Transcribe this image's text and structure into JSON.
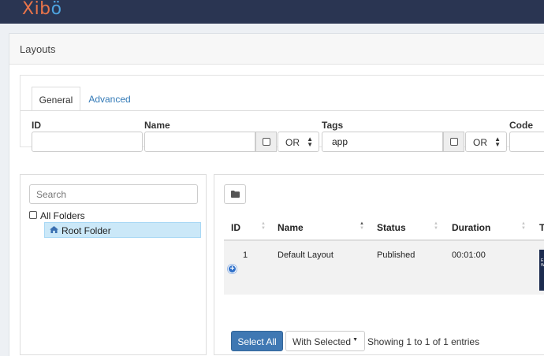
{
  "app": {
    "logo_part1": "Xib",
    "logo_part2": "ö"
  },
  "page": {
    "title": "Layouts"
  },
  "filter": {
    "tabs": [
      {
        "label": "General"
      },
      {
        "label": "Advanced"
      }
    ],
    "fields": {
      "id": {
        "label": "ID",
        "value": ""
      },
      "name": {
        "label": "Name",
        "value": "",
        "operator": "OR"
      },
      "tags": {
        "label": "Tags",
        "value": "app",
        "operator": "OR"
      },
      "code": {
        "label": "Code",
        "value": ""
      }
    }
  },
  "folders": {
    "search_placeholder": "Search",
    "all_folders": "All Folders",
    "root_folder": "Root Folder"
  },
  "table": {
    "columns": [
      "ID",
      "Name",
      "Status",
      "Duration",
      "T"
    ],
    "rows": [
      {
        "id": "1",
        "name": "Default Layout",
        "status": "Published",
        "duration": "00:01:00"
      }
    ]
  },
  "footer": {
    "select_all": "Select All",
    "with_selected": "With Selected",
    "showing": "Showing 1 to 1 of 1 entries"
  },
  "colors": {
    "topbar": "#2a3552",
    "primary_button": "#3f78b3",
    "selected_folder": "#cbe8f8",
    "logo_orange": "#e8744a",
    "logo_blue": "#4ea4e0"
  }
}
